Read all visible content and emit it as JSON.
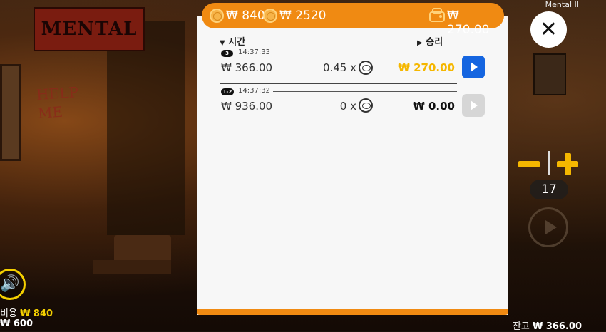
{
  "app": {
    "title": "Mental II",
    "logo_text": "MENTAL"
  },
  "scene": {
    "wall_writing": "HELP ME"
  },
  "topbar": {
    "bet_amount": "₩ 840",
    "coin_amount": "₩ 2520",
    "win_amount": "₩ 270.00"
  },
  "history": {
    "col_time": "시간",
    "col_win": "승리",
    "rows": [
      {
        "id": "3",
        "time": "14:37:33",
        "bet": "₩ 366.00",
        "multiplier": "0.45 x",
        "win": "₩ 270.00",
        "win_color": "#f5b700",
        "replay_active": true
      },
      {
        "id": "1-2",
        "time": "14:37:32",
        "bet": "₩ 936.00",
        "multiplier": "0 x",
        "win": "₩ 0.00",
        "win_color": "#111111",
        "replay_active": false
      }
    ]
  },
  "controls": {
    "close_symbol": "✕",
    "counter_value": "17",
    "sound_symbol": "🔊"
  },
  "footer": {
    "cost_label": "비용",
    "cost_value": "₩ 840",
    "bet_value": "₩ 600",
    "balance_label": "잔고",
    "balance_value": "₩ 366.00"
  },
  "colors": {
    "accent": "#f08a12",
    "gold": "#f5b700",
    "play_active": "#1565e0",
    "play_disabled": "#d6d6d6"
  }
}
